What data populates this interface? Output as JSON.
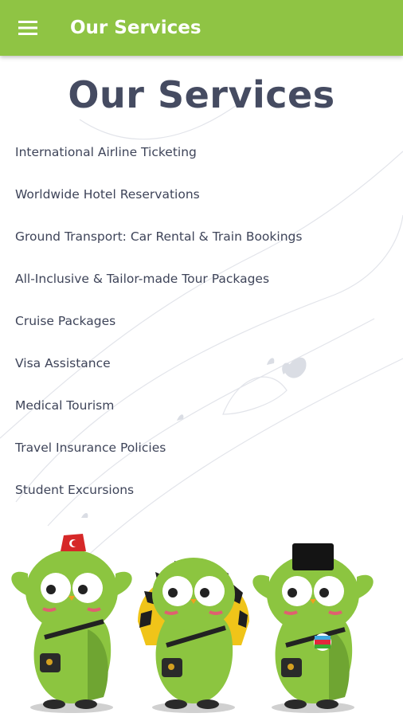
{
  "appbar": {
    "menu_icon": "hamburger-menu-icon",
    "title": "Our Services",
    "color": "#8fc444"
  },
  "page": {
    "title": "Our Services",
    "title_color": "#454b61"
  },
  "services": [
    "International Airline Ticketing",
    "Worldwide Hotel Reservations",
    "Ground Transport: Car Rental & Train Bookings",
    "All-Inclusive & Tailor-made Tour Packages",
    "Cruise Packages",
    "Visa Assistance",
    "Medical Tourism",
    "Travel Insurance Policies",
    "Student Excursions"
  ],
  "illustration": {
    "mascots": [
      {
        "name": "mascot-turkey",
        "hat": "fez with Turkish flag"
      },
      {
        "name": "mascot-egypt",
        "hat": "striped pharaoh headdress"
      },
      {
        "name": "mascot-azerbaijan",
        "hat": "black papakha hat",
        "badge": "Azerbaijan flag"
      }
    ],
    "body_color": "#8cc540"
  }
}
